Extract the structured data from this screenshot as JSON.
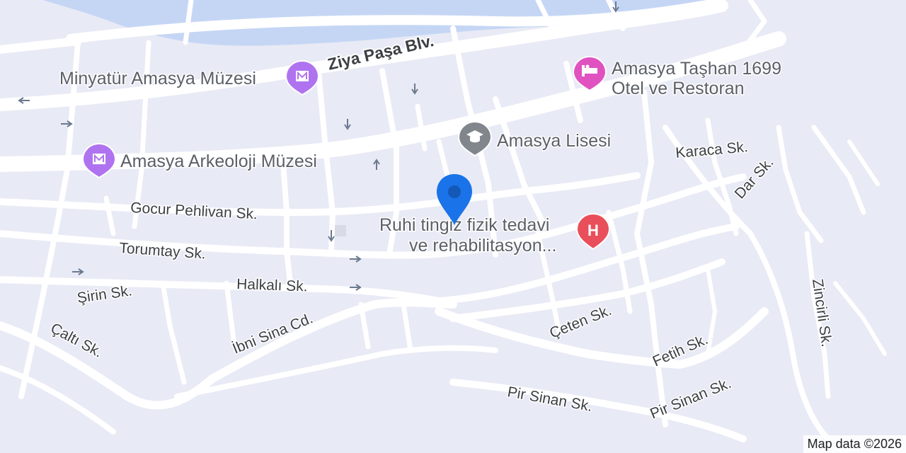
{
  "map": {
    "water_color": "#c5d6f5",
    "land_color": "#e8eaf5",
    "road_color": "#ffffff",
    "accent_location": "#1a73e8",
    "streets": [
      {
        "id": "ziya-pasa",
        "label": "Ziya Paşa Blv."
      },
      {
        "id": "karaca",
        "label": "Karaca Sk."
      },
      {
        "id": "dar",
        "label": "Dar Sk."
      },
      {
        "id": "gocur",
        "label": "Gocur Pehlivan Sk."
      },
      {
        "id": "torumtay",
        "label": "Torumtay Sk."
      },
      {
        "id": "halkali",
        "label": "Halkalı Sk."
      },
      {
        "id": "sirin",
        "label": "Şirin Sk."
      },
      {
        "id": "calti",
        "label": "Çaltı Sk."
      },
      {
        "id": "ibni-sina",
        "label": "İbni Sina Cd."
      },
      {
        "id": "ceten",
        "label": "Çeten Sk."
      },
      {
        "id": "fetih",
        "label": "Fetih Sk."
      },
      {
        "id": "zincirli",
        "label": "Zincirli Sk."
      },
      {
        "id": "pir-sinan-1",
        "label": "Pir Sinan Sk."
      },
      {
        "id": "pir-sinan-2",
        "label": "Pir Sinan Sk."
      }
    ],
    "pois": [
      {
        "id": "minyatur",
        "label": "Minyatür Amasya Müzesi",
        "icon": "museum-icon",
        "color": "#b073f0"
      },
      {
        "id": "arkeoloji",
        "label": "Amasya Arkeoloji Müzesi",
        "icon": "museum-icon",
        "color": "#b073f0"
      },
      {
        "id": "tashan",
        "label_line1": "Amasya Taşhan 1699",
        "label_line2": "Otel ve Restoran",
        "icon": "hotel-icon",
        "color": "#e052c0"
      },
      {
        "id": "lisesi",
        "label": "Amasya Lisesi",
        "icon": "school-icon",
        "color": "#80868b"
      },
      {
        "id": "ruhi",
        "label_line1": "Ruhi tingiz fizik tedavi",
        "label_line2": "ve rehabilitasyon...",
        "icon": "hospital-icon",
        "color": "#e94f5a"
      }
    ],
    "attribution": "Map data ©2026"
  }
}
